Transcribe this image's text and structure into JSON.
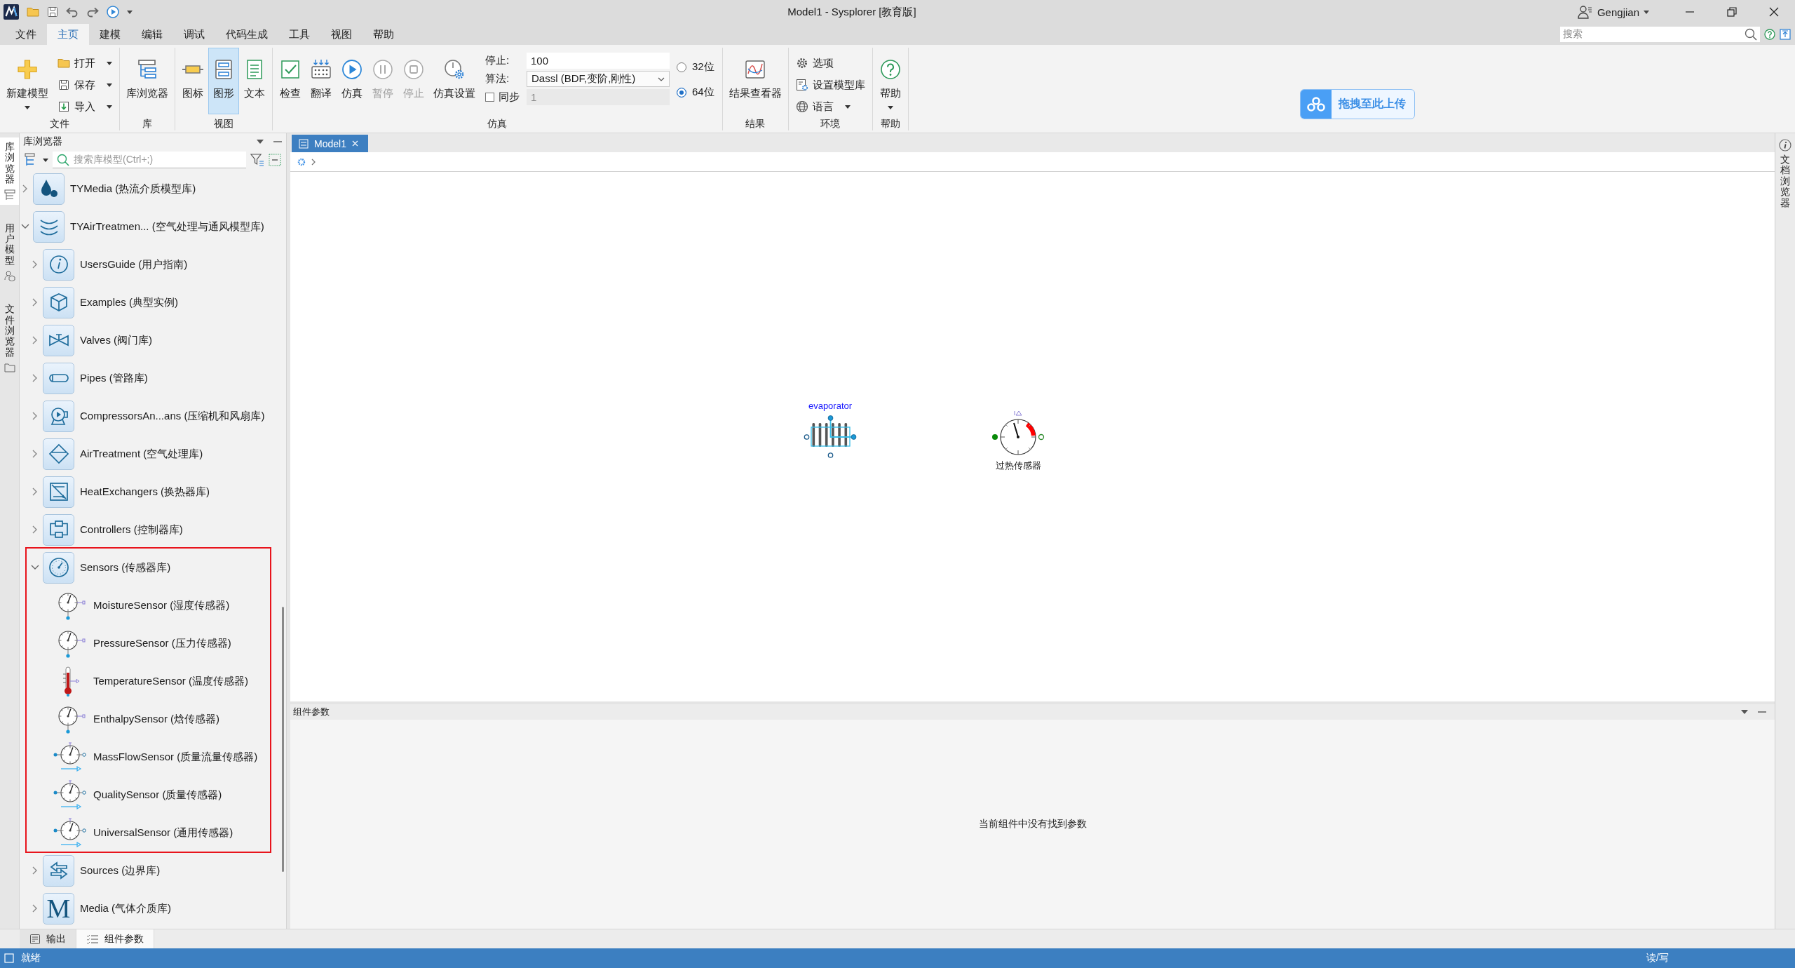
{
  "window": {
    "title": "Model1 - Sysplorer [教育版]",
    "user": "Gengjian"
  },
  "menu": [
    {
      "label": "文件",
      "selected": false
    },
    {
      "label": "主页",
      "selected": true
    },
    {
      "label": "建模",
      "selected": false
    },
    {
      "label": "编辑",
      "selected": false
    },
    {
      "label": "调试",
      "selected": false
    },
    {
      "label": "代码生成",
      "selected": false
    },
    {
      "label": "工具",
      "selected": false
    },
    {
      "label": "视图",
      "selected": false
    },
    {
      "label": "帮助",
      "selected": false
    }
  ],
  "search": {
    "placeholder": "搜索"
  },
  "ribbon": [
    {
      "title": "文件",
      "items": [
        {
          "kind": "large",
          "label": "新建模型",
          "dropdown": true
        },
        {
          "kind": "stack",
          "entries": [
            {
              "label": "打开",
              "dropdown": true
            },
            {
              "label": "保存",
              "dropdown": true
            },
            {
              "label": "导入",
              "dropdown": true
            }
          ]
        }
      ]
    },
    {
      "title": "库",
      "items": [
        {
          "kind": "large",
          "label": "库浏览器",
          "dropdown": false
        }
      ]
    },
    {
      "title": "视图",
      "items": [
        {
          "kind": "large",
          "label": "图标",
          "dropdown": false,
          "selected": false
        },
        {
          "kind": "large",
          "label": "图形",
          "dropdown": false,
          "selected": true
        },
        {
          "kind": "large",
          "label": "文本",
          "dropdown": false,
          "selected": false
        }
      ]
    },
    {
      "title": "仿真",
      "items": [
        {
          "kind": "large",
          "label": "检查",
          "dropdown": false,
          "disabled": false
        },
        {
          "kind": "large",
          "label": "翻译",
          "dropdown": false,
          "disabled": false
        },
        {
          "kind": "large",
          "label": "仿真",
          "dropdown": false,
          "disabled": false
        },
        {
          "kind": "large",
          "label": "暂停",
          "dropdown": false,
          "disabled": true
        },
        {
          "kind": "large",
          "label": "停止",
          "dropdown": false,
          "disabled": true
        },
        {
          "kind": "large",
          "label": "仿真设置",
          "dropdown": false,
          "disabled": false
        },
        {
          "kind": "settings",
          "stop_label": "停止:",
          "stop_value": "100",
          "algorithm_label": "算法:",
          "algorithm_value": "Dassl (BDF,变阶,刚性)",
          "sync_label": "同步",
          "sync_checked": false,
          "sync_value": "1"
        },
        {
          "kind": "radios",
          "options": [
            {
              "label": "32位",
              "selected": false
            },
            {
              "label": "64位",
              "selected": true
            }
          ]
        }
      ]
    },
    {
      "title": "结果",
      "items": [
        {
          "kind": "large",
          "label": "结果查看器",
          "dropdown": false
        }
      ]
    },
    {
      "title": "环境",
      "items": [
        {
          "kind": "stack",
          "entries": [
            {
              "label": "选项",
              "dropdown": false
            },
            {
              "label": "设置模型库",
              "dropdown": false
            },
            {
              "label": "语言",
              "dropdown": true
            }
          ]
        }
      ]
    },
    {
      "title": "帮助",
      "items": [
        {
          "kind": "large",
          "label": "帮助",
          "dropdown": true
        }
      ]
    }
  ],
  "upload_button": {
    "label": "拖拽至此上传"
  },
  "side_tabs": [
    {
      "label": "库浏览器",
      "selected": true
    },
    {
      "label": "用户模型",
      "selected": false
    },
    {
      "label": "文件浏览器",
      "selected": false
    }
  ],
  "library_browser": {
    "title": "库浏览器",
    "search_placeholder": "搜索库模型(Ctrl+;)",
    "tree": [
      {
        "label": "TYMedia (热流介质模型库)",
        "expanded": false
      },
      {
        "label": "TYAirTreatmen... (空气处理与通风模型库)",
        "expanded": true,
        "children": [
          {
            "label": "UsersGuide (用户指南)",
            "expanded": false,
            "highlighted": false
          },
          {
            "label": "Examples (典型实例)",
            "expanded": false,
            "highlighted": false
          },
          {
            "label": "Valves (阀门库)",
            "expanded": false,
            "highlighted": false
          },
          {
            "label": "Pipes (管路库)",
            "expanded": false,
            "highlighted": false
          },
          {
            "label": "CompressorsAn...ans (压缩机和风扇库)",
            "expanded": false,
            "highlighted": false
          },
          {
            "label": "AirTreatment (空气处理库)",
            "expanded": false,
            "highlighted": false
          },
          {
            "label": "HeatExchangers (换热器库)",
            "expanded": false,
            "highlighted": false
          },
          {
            "label": "Controllers (控制器库)",
            "expanded": false,
            "highlighted": false
          },
          {
            "label": "Sensors (传感器库)",
            "expanded": true,
            "highlighted": true,
            "children": [
              {
                "label": "MoistureSensor (湿度传感器)"
              },
              {
                "label": "PressureSensor (压力传感器)"
              },
              {
                "label": "TemperatureSensor (温度传感器)"
              },
              {
                "label": "EnthalpySensor (焓传感器)"
              },
              {
                "label": "MassFlowSensor (质量流量传感器)"
              },
              {
                "label": "QualitySensor (质量传感器)"
              },
              {
                "label": "UniversalSensor (通用传感器)"
              }
            ]
          },
          {
            "label": "Sources (边界库)",
            "expanded": false,
            "highlighted": false
          },
          {
            "label": "Media (气体介质库)",
            "expanded": false,
            "highlighted": false,
            "icon_text": "M"
          }
        ]
      }
    ]
  },
  "editor": {
    "tabs": [
      {
        "label": "Model1",
        "selected": true
      }
    ],
    "components": [
      {
        "kind": "exchanger",
        "label": "evaporator"
      },
      {
        "kind": "sensor",
        "label": "过热传感器"
      }
    ]
  },
  "params_panel": {
    "title": "组件参数",
    "message": "当前组件中没有找到参数"
  },
  "doc_tab": {
    "label": "文档浏览器"
  },
  "dock_tabs": [
    {
      "label": "输出",
      "selected": false
    },
    {
      "label": "组件参数",
      "selected": true
    }
  ],
  "status_bar": {
    "left": "就绪",
    "right": "读/写"
  }
}
